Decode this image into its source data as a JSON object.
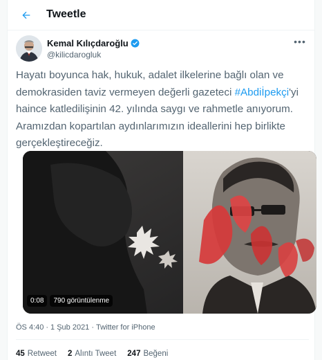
{
  "header": {
    "title": "Tweetle",
    "back_icon": "arrow-left-icon"
  },
  "author": {
    "name": "Kemal Kılıçdaroğlu",
    "handle": "@kilicdarogluk",
    "verified_icon": "verified-badge-icon",
    "more_icon": "more-horizontal-icon",
    "verified_color": "#1d9bf0"
  },
  "tweet": {
    "text_before": "Hayatı boyunca hak, hukuk, adalet ilkelerine bağlı olan ve demokrasiden taviz vermeyen değerli gazeteci ",
    "hashtag": "#Abdiİpekçi",
    "text_after": "'yi haince katledilişinin 42. yılında saygı ve rahmetle anıyorum. Aramızdan kopartılan aydınlarımızın ideallerini hep birlikte gerçekleştireceğiz."
  },
  "media": {
    "duration": "0:08",
    "views": "790 görüntülenme"
  },
  "meta": {
    "time": "ÖS 4:40",
    "date": "1 Şub 2021",
    "source": "Twitter for iPhone",
    "separator": "·"
  },
  "stats": {
    "retweets_count": "45",
    "retweets_label": "Retweet",
    "quotes_count": "2",
    "quotes_label": "Alıntı Tweet",
    "likes_count": "247",
    "likes_label": "Beğeni"
  },
  "colors": {
    "accent": "#1d9bf0",
    "text_secondary": "#536471"
  }
}
